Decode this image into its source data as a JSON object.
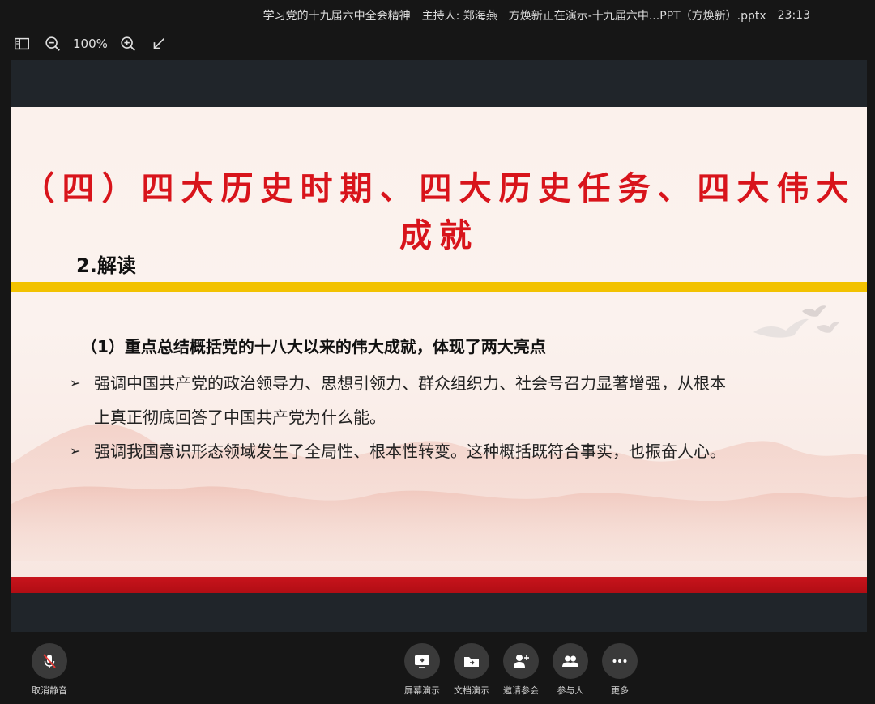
{
  "titlebar": {
    "meeting_title": "学习党的十九届六中全会精神",
    "host": "主持人: 郑海燕",
    "presenting": "方焕新正在演示-十九届六中...PPT（方焕新）.pptx",
    "time": "23:13"
  },
  "toolbar": {
    "zoom_level": "100%",
    "icons": [
      "sidebar-icon",
      "zoom-out-icon",
      "zoom-in-icon",
      "collapse-icon"
    ]
  },
  "slide": {
    "title": "（四）四大历史时期、四大历史任务、四大伟大成就",
    "subtitle": "2.解读",
    "section_title": "（1）重点总结概括党的十八大以来的伟大成就，体现了两大亮点",
    "bullets": [
      {
        "line1": "强调中国共产党的政治领导力、思想引领力、群众组织力、社会号召力显著增强，从根本",
        "line2": "上真正彻底回答了中国共产党为什么能。"
      },
      {
        "line1": "强调我国意识形态领域发生了全局性、根本性转变。这种概括既符合事实，也振奋人心。"
      }
    ],
    "colors": {
      "title": "#d8141b",
      "yellow_band": "#f2c200",
      "red_band": "#c8141c"
    }
  },
  "controls": {
    "unmute": "取消静音",
    "screen_share": "屏幕演示",
    "doc_share": "文档演示",
    "invite": "邀请参会",
    "participants": "参与人",
    "more": "更多"
  }
}
